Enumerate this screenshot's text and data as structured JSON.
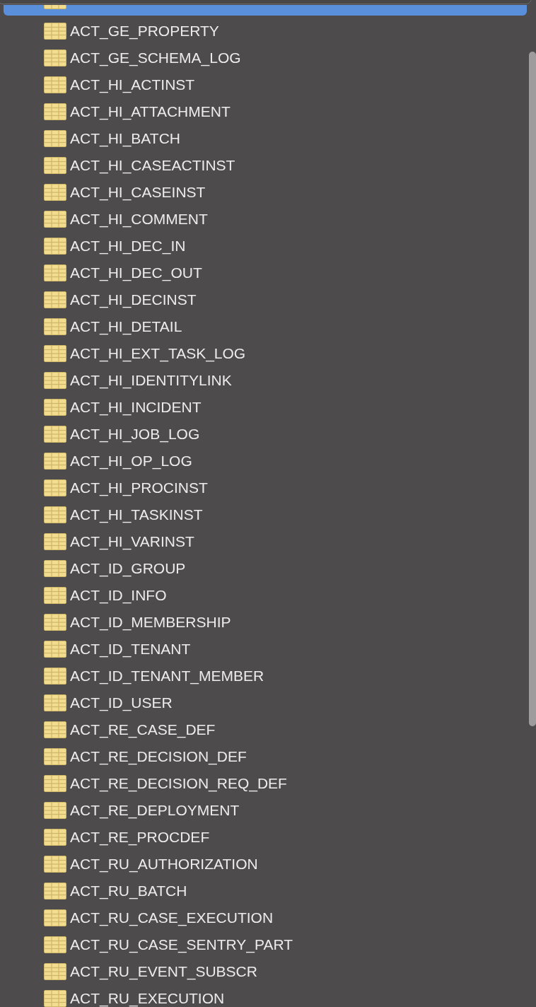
{
  "tables": [
    {
      "selected": true
    },
    {
      "label": "ACT_GE_PROPERTY",
      "selected": false
    },
    {
      "label": "ACT_GE_SCHEMA_LOG",
      "selected": false
    },
    {
      "label": "ACT_HI_ACTINST",
      "selected": false
    },
    {
      "label": "ACT_HI_ATTACHMENT",
      "selected": false
    },
    {
      "label": "ACT_HI_BATCH",
      "selected": false
    },
    {
      "label": "ACT_HI_CASEACTINST",
      "selected": false
    },
    {
      "label": "ACT_HI_CASEINST",
      "selected": false
    },
    {
      "label": "ACT_HI_COMMENT",
      "selected": false
    },
    {
      "label": "ACT_HI_DEC_IN",
      "selected": false
    },
    {
      "label": "ACT_HI_DEC_OUT",
      "selected": false
    },
    {
      "label": "ACT_HI_DECINST",
      "selected": false
    },
    {
      "label": "ACT_HI_DETAIL",
      "selected": false
    },
    {
      "label": "ACT_HI_EXT_TASK_LOG",
      "selected": false
    },
    {
      "label": "ACT_HI_IDENTITYLINK",
      "selected": false
    },
    {
      "label": "ACT_HI_INCIDENT",
      "selected": false
    },
    {
      "label": "ACT_HI_JOB_LOG",
      "selected": false
    },
    {
      "label": "ACT_HI_OP_LOG",
      "selected": false
    },
    {
      "label": "ACT_HI_PROCINST",
      "selected": false
    },
    {
      "label": "ACT_HI_TASKINST",
      "selected": false
    },
    {
      "label": "ACT_HI_VARINST",
      "selected": false
    },
    {
      "label": "ACT_ID_GROUP",
      "selected": false
    },
    {
      "label": "ACT_ID_INFO",
      "selected": false
    },
    {
      "label": "ACT_ID_MEMBERSHIP",
      "selected": false
    },
    {
      "label": "ACT_ID_TENANT",
      "selected": false
    },
    {
      "label": "ACT_ID_TENANT_MEMBER",
      "selected": false
    },
    {
      "label": "ACT_ID_USER",
      "selected": false
    },
    {
      "label": "ACT_RE_CASE_DEF",
      "selected": false
    },
    {
      "label": "ACT_RE_DECISION_DEF",
      "selected": false
    },
    {
      "label": "ACT_RE_DECISION_REQ_DEF",
      "selected": false
    },
    {
      "label": "ACT_RE_DEPLOYMENT",
      "selected": false
    },
    {
      "label": "ACT_RE_PROCDEF",
      "selected": false
    },
    {
      "label": "ACT_RU_AUTHORIZATION",
      "selected": false
    },
    {
      "label": "ACT_RU_BATCH",
      "selected": false
    },
    {
      "label": "ACT_RU_CASE_EXECUTION",
      "selected": false
    },
    {
      "label": "ACT_RU_CASE_SENTRY_PART",
      "selected": false
    },
    {
      "label": "ACT_RU_EVENT_SUBSCR",
      "selected": false
    },
    {
      "label": "ACT_RU_EXECUTION",
      "selected": false
    }
  ]
}
